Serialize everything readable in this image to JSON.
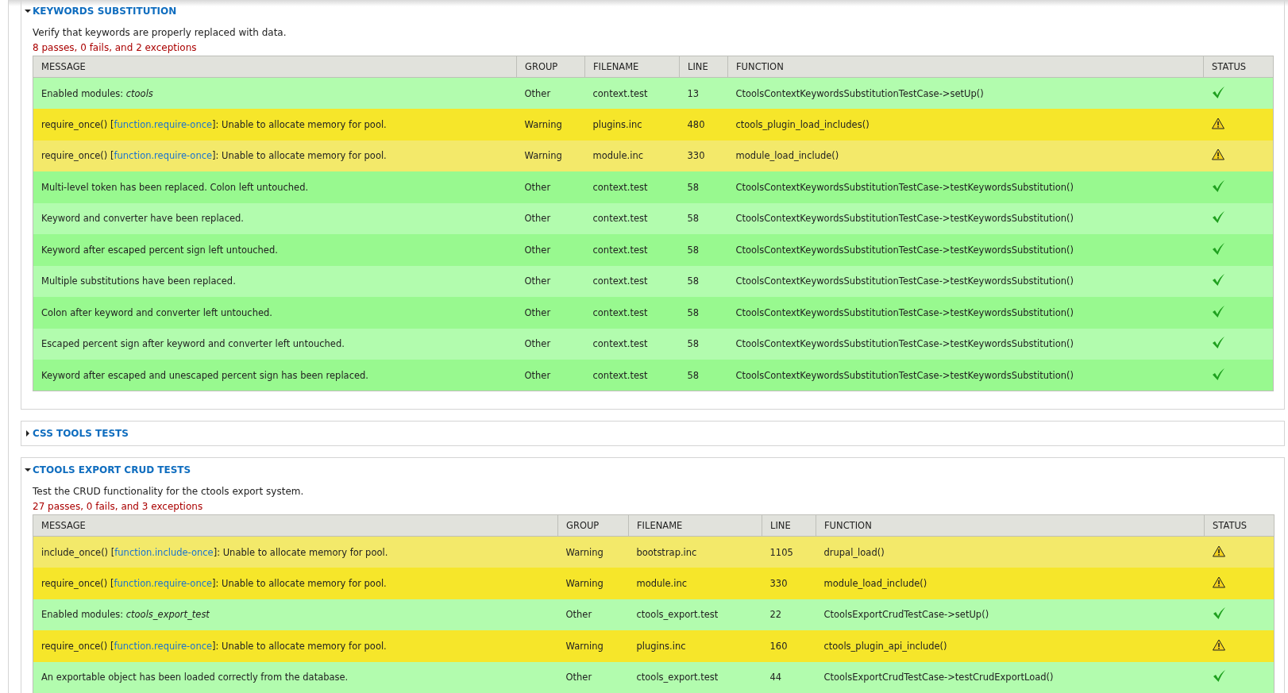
{
  "sections": [
    {
      "title": "KEYWORDS SUBSTITUTION",
      "expanded": true,
      "description": "Verify that keywords are properly replaced with data.",
      "summary": "8 passes, 0 fails, and 2 exceptions",
      "columns": [
        "MESSAGE",
        "GROUP",
        "FILENAME",
        "LINE",
        "FUNCTION",
        "STATUS"
      ],
      "rows": [
        {
          "kind": "pass",
          "message": "Enabled modules: *ctools*",
          "group": "Other",
          "filename": "context.test",
          "line": "13",
          "function": "CtoolsContextKeywordsSubstitutionTestCase->setUp()"
        },
        {
          "kind": "exception",
          "message": "require_once() [",
          "link": "function.require-once",
          "message_end": "]: Unable to allocate memory for pool.",
          "group": "Warning",
          "filename": "plugins.inc",
          "line": "480",
          "function": "ctools_plugin_load_includes()"
        },
        {
          "kind": "exception",
          "message": "require_once() [",
          "link": "function.require-once",
          "message_end": "]: Unable to allocate memory for pool.",
          "group": "Warning",
          "filename": "module.inc",
          "line": "330",
          "function": "module_load_include()"
        },
        {
          "kind": "pass",
          "message": "Multi-level token has been replaced. Colon left untouched.",
          "group": "Other",
          "filename": "context.test",
          "line": "58",
          "function": "CtoolsContextKeywordsSubstitutionTestCase->testKeywordsSubstitution()"
        },
        {
          "kind": "pass",
          "message": "Keyword and converter have been replaced.",
          "group": "Other",
          "filename": "context.test",
          "line": "58",
          "function": "CtoolsContextKeywordsSubstitutionTestCase->testKeywordsSubstitution()"
        },
        {
          "kind": "pass",
          "message": "Keyword after escaped percent sign left untouched.",
          "group": "Other",
          "filename": "context.test",
          "line": "58",
          "function": "CtoolsContextKeywordsSubstitutionTestCase->testKeywordsSubstitution()"
        },
        {
          "kind": "pass",
          "message": "Multiple substitutions have been replaced.",
          "group": "Other",
          "filename": "context.test",
          "line": "58",
          "function": "CtoolsContextKeywordsSubstitutionTestCase->testKeywordsSubstitution()"
        },
        {
          "kind": "pass",
          "message": "Colon after keyword and converter left untouched.",
          "group": "Other",
          "filename": "context.test",
          "line": "58",
          "function": "CtoolsContextKeywordsSubstitutionTestCase->testKeywordsSubstitution()"
        },
        {
          "kind": "pass",
          "message": "Escaped percent sign after keyword and converter left untouched.",
          "group": "Other",
          "filename": "context.test",
          "line": "58",
          "function": "CtoolsContextKeywordsSubstitutionTestCase->testKeywordsSubstitution()"
        },
        {
          "kind": "pass",
          "message": "Keyword after escaped and unescaped percent sign has been replaced.",
          "group": "Other",
          "filename": "context.test",
          "line": "58",
          "function": "CtoolsContextKeywordsSubstitutionTestCase->testKeywordsSubstitution()"
        }
      ]
    },
    {
      "title": "CSS TOOLS TESTS",
      "expanded": false
    },
    {
      "title": "CTOOLS EXPORT CRUD TESTS",
      "expanded": true,
      "description": "Test the CRUD functionality for the ctools export system.",
      "summary": "27 passes, 0 fails, and 3 exceptions",
      "columns": [
        "MESSAGE",
        "GROUP",
        "FILENAME",
        "LINE",
        "FUNCTION",
        "STATUS"
      ],
      "rows": [
        {
          "kind": "exception",
          "message": "include_once() [",
          "link": "function.include-once",
          "message_end": "]: Unable to allocate memory for pool.",
          "group": "Warning",
          "filename": "bootstrap.inc",
          "line": "1105",
          "function": "drupal_load()"
        },
        {
          "kind": "exception",
          "message": "require_once() [",
          "link": "function.require-once",
          "message_end": "]: Unable to allocate memory for pool.",
          "group": "Warning",
          "filename": "module.inc",
          "line": "330",
          "function": "module_load_include()"
        },
        {
          "kind": "pass",
          "message": "Enabled modules: *ctools_export_test*",
          "group": "Other",
          "filename": "ctools_export.test",
          "line": "22",
          "function": "CtoolsExportCrudTestCase->setUp()"
        },
        {
          "kind": "exception",
          "message": "require_once() [",
          "link": "function.require-once",
          "message_end": "]: Unable to allocate memory for pool.",
          "group": "Warning",
          "filename": "plugins.inc",
          "line": "160",
          "function": "ctools_plugin_api_include()"
        },
        {
          "kind": "pass",
          "message": "An exportable object has been loaded correctly from the database.",
          "group": "Other",
          "filename": "ctools_export.test",
          "line": "44",
          "function": "CtoolsExportCrudTestCase->testCrudExportLoad()"
        }
      ]
    }
  ]
}
